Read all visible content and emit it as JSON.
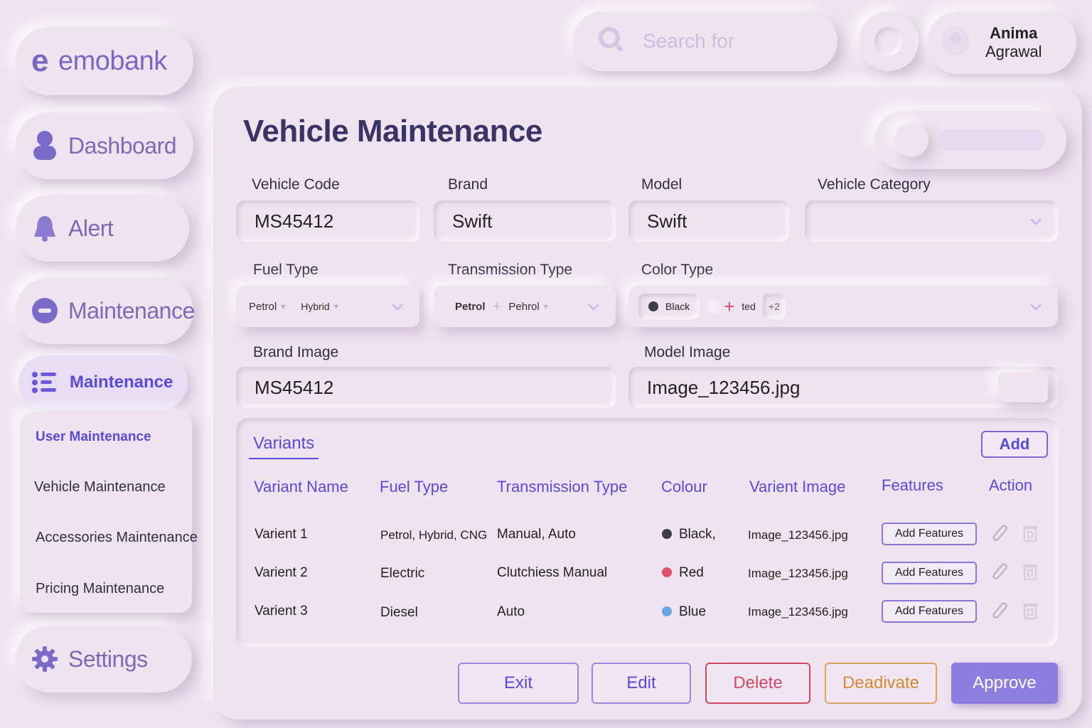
{
  "brand": {
    "logo_mark": "e",
    "name": "emobank"
  },
  "sidebar": {
    "items": [
      {
        "label": "Dashboard",
        "icon": "user-icon"
      },
      {
        "label": "Alert",
        "icon": "bell-icon"
      },
      {
        "label": "Maintenance",
        "icon": "minus-circle-icon"
      },
      {
        "label": "Maintenance",
        "icon": "list-icon",
        "active": true
      }
    ],
    "submenu": [
      "User Maintenance",
      "Vehicle Maintenance",
      "Accessories Maintenance",
      "Pricing Maintenance"
    ],
    "settings_label": "Settings"
  },
  "search": {
    "placeholder": "Search for"
  },
  "user": {
    "first_name": "Anima",
    "last_name": "Agrawal"
  },
  "page": {
    "title": "Vehicle Maintenance"
  },
  "form": {
    "vehicle_code": {
      "label": "Vehicle Code",
      "value": "MS45412"
    },
    "brand": {
      "label": "Brand",
      "value": "Swift"
    },
    "model": {
      "label": "Model",
      "value": "Swift"
    },
    "vehicle_category": {
      "label": "Vehicle Category",
      "value": ""
    },
    "fuel_type": {
      "label": "Fuel Type",
      "chips": [
        "Petrol",
        "Hybrid"
      ]
    },
    "transmission_type": {
      "label": "Transmission Type",
      "chips": [
        "Petrol",
        "Pehrol"
      ]
    },
    "color_type": {
      "label": "Color Type",
      "chips": [
        "Black",
        "ted"
      ],
      "more": "+2"
    },
    "brand_image": {
      "label": "Brand Image",
      "value": "MS45412"
    },
    "model_image": {
      "label": "Model Image",
      "value": "Image_123456.jpg"
    }
  },
  "variants": {
    "tab_label": "Variants",
    "add_label": "Add",
    "columns": [
      "Variant Name",
      "Fuel Type",
      "Transmission Type",
      "Colour",
      "Varient Image",
      "Features",
      "Action"
    ],
    "rows": [
      {
        "name": "Varient 1",
        "fuel": "Petrol, Hybrid, CNG",
        "transmission": "Manual, Auto",
        "colour": "Black,",
        "colour_hex": "#3d3d45",
        "image": "Image_123456.jpg",
        "features": "Add Features"
      },
      {
        "name": "Varient 2",
        "fuel": "Electric",
        "transmission": "Clutchiess Manual",
        "colour": "Red",
        "colour_hex": "#e0506a",
        "image": "Image_123456.jpg",
        "features": "Add Features"
      },
      {
        "name": "Varient 3",
        "fuel": "Diesel",
        "transmission": "Auto",
        "colour": "Blue",
        "colour_hex": "#6aa4e4",
        "image": "Image_123456.jpg",
        "features": "Add Features"
      }
    ]
  },
  "actions": {
    "exit": "Exit",
    "edit": "Edit",
    "delete": "Delete",
    "deactivate": "Deadivate",
    "approve": "Approve"
  },
  "colors": {
    "accent": "#5a4ad8",
    "delete": "#d04a62",
    "deactivate": "#d8882e",
    "approve": "#8e7ce0"
  }
}
